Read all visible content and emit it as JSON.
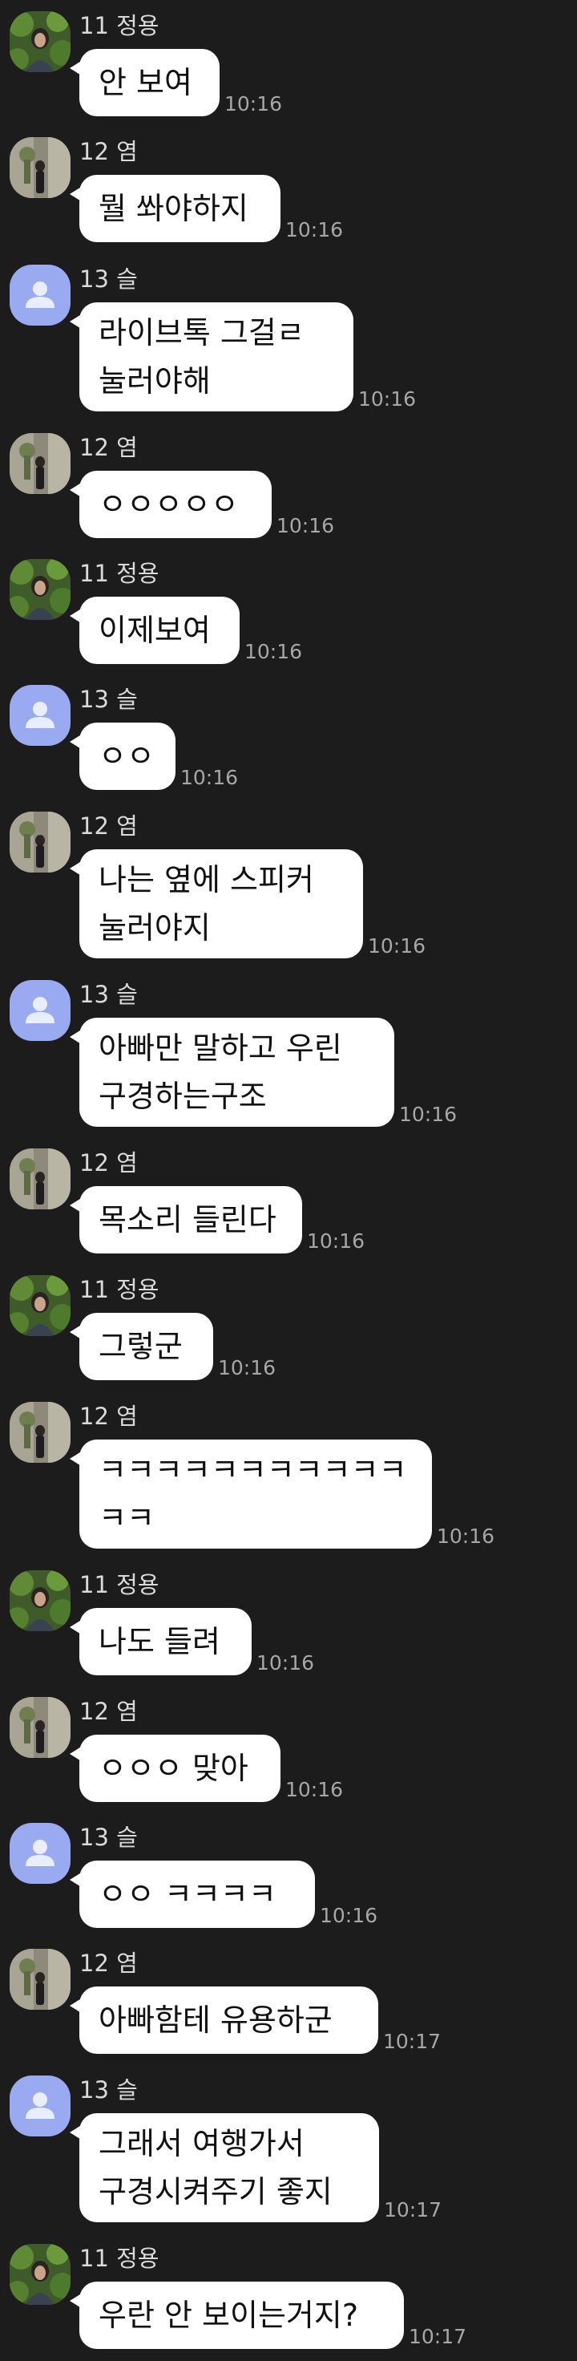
{
  "avatars": {
    "jungyong": "green-foliage-photo",
    "yeom": "beige-room-photo",
    "seul": "default-person-icon"
  },
  "messages": [
    {
      "sender": "11 정용",
      "avatar": "jungyong",
      "text": "안 보여",
      "time": "10:16"
    },
    {
      "sender": "12 염",
      "avatar": "yeom",
      "text": "뭘 쏴야하지",
      "time": "10:16"
    },
    {
      "sender": "13 슬",
      "avatar": "seul",
      "text": "라이브톡 그걸ㄹ\n눌러야해",
      "time": "10:16"
    },
    {
      "sender": "12 염",
      "avatar": "yeom",
      "text": "ㅇㅇㅇㅇㅇ",
      "time": "10:16"
    },
    {
      "sender": "11 정용",
      "avatar": "jungyong",
      "text": "이제보여",
      "time": "10:16"
    },
    {
      "sender": "13 슬",
      "avatar": "seul",
      "text": "ㅇㅇ",
      "time": "10:16"
    },
    {
      "sender": "12 염",
      "avatar": "yeom",
      "text": "나는 옆에 스피커\n눌러야지",
      "time": "10:16"
    },
    {
      "sender": "13 슬",
      "avatar": "seul",
      "text": "아빠만 말하고 우린\n구경하는구조",
      "time": "10:16"
    },
    {
      "sender": "12 염",
      "avatar": "yeom",
      "text": "목소리 들린다",
      "time": "10:16"
    },
    {
      "sender": "11 정용",
      "avatar": "jungyong",
      "text": "그렇군",
      "time": "10:16"
    },
    {
      "sender": "12 염",
      "avatar": "yeom",
      "text": "ㅋㅋㅋㅋㅋㅋㅋㅋㅋㅋㅋ\nㅋㅋ",
      "time": "10:16"
    },
    {
      "sender": "11 정용",
      "avatar": "jungyong",
      "text": "나도 들려",
      "time": "10:16"
    },
    {
      "sender": "12 염",
      "avatar": "yeom",
      "text": "ㅇㅇㅇ 맞아",
      "time": "10:16"
    },
    {
      "sender": "13 슬",
      "avatar": "seul",
      "text": "ㅇㅇ ㅋㅋㅋㅋ",
      "time": "10:16"
    },
    {
      "sender": "12 염",
      "avatar": "yeom",
      "text": "아빠함테 유용하군",
      "time": "10:17"
    },
    {
      "sender": "13 슬",
      "avatar": "seul",
      "text": "그래서 여행가서\n구경시켜주기 좋지",
      "time": "10:17"
    },
    {
      "sender": "11 정용",
      "avatar": "jungyong",
      "text": "우란 안 보이는거지?",
      "time": "10:17"
    }
  ]
}
